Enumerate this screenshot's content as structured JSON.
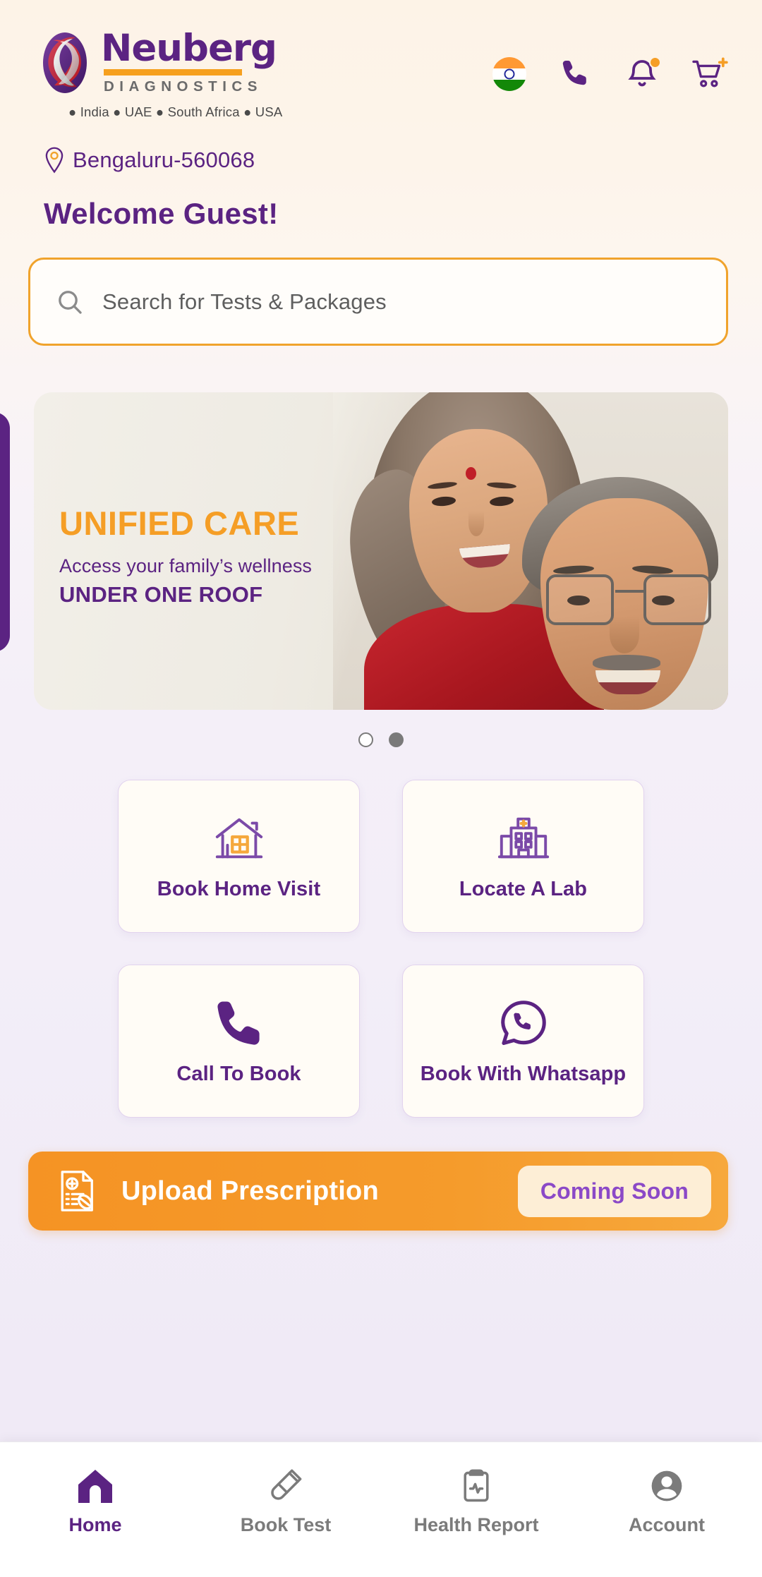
{
  "header": {
    "brand_name": "Neuberg",
    "brand_sub": "DIAGNOSTICS",
    "brand_countries": "● India ● UAE ● South Africa ● USA",
    "icons": [
      {
        "name": "india-flag-icon",
        "label": "India"
      },
      {
        "name": "phone-icon",
        "label": "Call"
      },
      {
        "name": "bell-icon",
        "label": "Notifications"
      },
      {
        "name": "cart-add-icon",
        "label": "Cart"
      }
    ]
  },
  "location": {
    "icon": "location-pin-icon",
    "text": "Bengaluru-560068"
  },
  "greeting": "Welcome  Guest!",
  "search": {
    "icon": "search-icon",
    "placeholder": "Search for Tests & Packages",
    "value": ""
  },
  "carousel": {
    "slides": [
      {
        "title": "UNIFIED CARE",
        "subtitle": "Access your family’s wellness",
        "tagline": "UNDER ONE ROOF"
      }
    ],
    "dots": [
      {
        "active": false
      },
      {
        "active": true
      }
    ]
  },
  "quick_actions": [
    {
      "label": "Book Home Visit",
      "icon": "home-house-icon"
    },
    {
      "label": "Locate A Lab",
      "icon": "hospital-building-icon"
    },
    {
      "label": "Call To Book",
      "icon": "phone-icon"
    },
    {
      "label": "Book With Whatsapp",
      "icon": "whatsapp-icon"
    }
  ],
  "prescription": {
    "icon": "prescription-document-icon",
    "title": "Upload Prescription",
    "badge": "Coming Soon"
  },
  "bottom_nav": [
    {
      "label": "Home",
      "icon": "home-icon",
      "active": true
    },
    {
      "label": "Book Test",
      "icon": "test-tube-icon",
      "active": false
    },
    {
      "label": "Health Report",
      "icon": "clipboard-heartbeat-icon",
      "active": false
    },
    {
      "label": "Account",
      "icon": "person-avatar-icon",
      "active": false
    }
  ],
  "colors": {
    "brand_purple": "#5b2382",
    "brand_orange": "#f59e26",
    "nav_inactive": "#7b7b7b",
    "badge_text": "#8b49c7"
  }
}
